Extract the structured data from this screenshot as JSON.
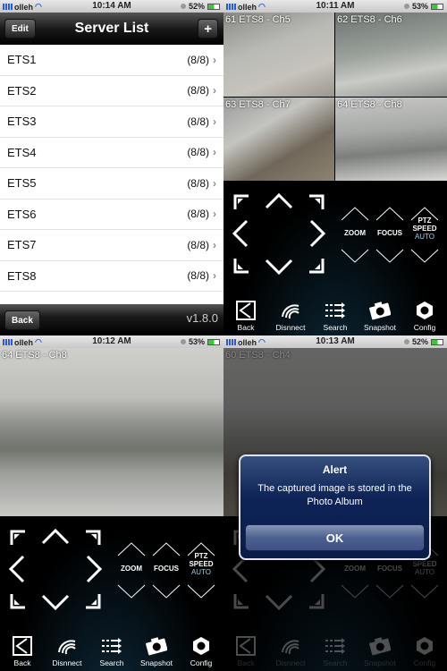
{
  "panel1": {
    "status": {
      "carrier": "olleh",
      "time": "10:14 AM",
      "battery": "52%"
    },
    "nav": {
      "title": "Server List",
      "edit": "Edit",
      "add": "+"
    },
    "servers": [
      {
        "name": "ETS1",
        "count": "(8/8)"
      },
      {
        "name": "ETS2",
        "count": "(8/8)"
      },
      {
        "name": "ETS3",
        "count": "(8/8)"
      },
      {
        "name": "ETS4",
        "count": "(8/8)"
      },
      {
        "name": "ETS5",
        "count": "(8/8)"
      },
      {
        "name": "ETS6",
        "count": "(8/8)"
      },
      {
        "name": "ETS7",
        "count": "(8/8)"
      },
      {
        "name": "ETS8",
        "count": "(8/8)"
      }
    ],
    "back": "Back",
    "version": "v1.8.0"
  },
  "panel2": {
    "status": {
      "carrier": "olleh",
      "time": "10:11 AM",
      "battery": "53%"
    },
    "cameras": [
      "61 ETS8 - Ch5",
      "62 ETS8 - Ch6",
      "63 ETS8 - Ch7",
      "64 ETS8 - Ch8"
    ]
  },
  "panel3": {
    "status": {
      "carrier": "olleh",
      "time": "10:12 AM",
      "battery": "53%"
    },
    "camera": "64 ETS8 - Ch8"
  },
  "panel4": {
    "status": {
      "carrier": "olleh",
      "time": "10:13 AM",
      "battery": "52%"
    },
    "camera": "60 ETS8 - Ch4",
    "alert": {
      "title": "Alert",
      "message": "The captured image is stored in the Photo Album",
      "ok": "OK"
    }
  },
  "controls": {
    "zoom": "ZOOM",
    "focus": "FOCUS",
    "ptz": "PTZ",
    "speed": "SPEED",
    "auto": "AUTO"
  },
  "toolbar": [
    "Back",
    "Disnnect",
    "Search",
    "Snapshot",
    "Config"
  ]
}
